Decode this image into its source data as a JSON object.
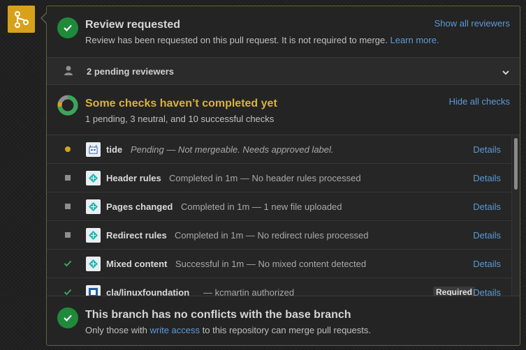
{
  "review": {
    "title": "Review requested",
    "text": "Review has been requested on this pull request. It is not required to merge.",
    "learn_more": "Learn more.",
    "show_reviewers": "Show all reviewers"
  },
  "pending": {
    "label": "2 pending reviewers"
  },
  "checks": {
    "title": "Some checks haven’t completed yet",
    "summary": "1 pending, 3 neutral, and 10 successful checks",
    "hide_all": "Hide all checks",
    "details_label": "Details",
    "required_label": "Required",
    "items": [
      {
        "name": "tide",
        "status": "pending",
        "desc": "Pending — Not mergeable. Needs approved label.",
        "icon": "tide-icon"
      },
      {
        "name": "Header rules",
        "status": "neutral",
        "desc": "Completed in 1m — No header rules processed",
        "icon": "netlify-icon"
      },
      {
        "name": "Pages changed",
        "status": "neutral",
        "desc": "Completed in 1m — 1 new file uploaded",
        "icon": "netlify-icon"
      },
      {
        "name": "Redirect rules",
        "status": "neutral",
        "desc": "Completed in 1m — No redirect rules processed",
        "icon": "netlify-icon"
      },
      {
        "name": "Mixed content",
        "status": "success",
        "desc": "Successful in 1m — No mixed content detected",
        "icon": "netlify-icon"
      },
      {
        "name": "cla/linuxfoundation",
        "status": "success",
        "desc": "— kcmartin authorized",
        "icon": "linuxfoundation-icon",
        "required": true
      }
    ]
  },
  "merge": {
    "title": "This branch has no conflicts with the base branch",
    "text_before": "Only those with",
    "link": "write access",
    "text_after": "to this repository can merge pull requests."
  },
  "colors": {
    "success": "#1f8a3a",
    "pending": "#d7a21a",
    "link": "#5a9bd8",
    "warning_title": "#d7b33a"
  }
}
